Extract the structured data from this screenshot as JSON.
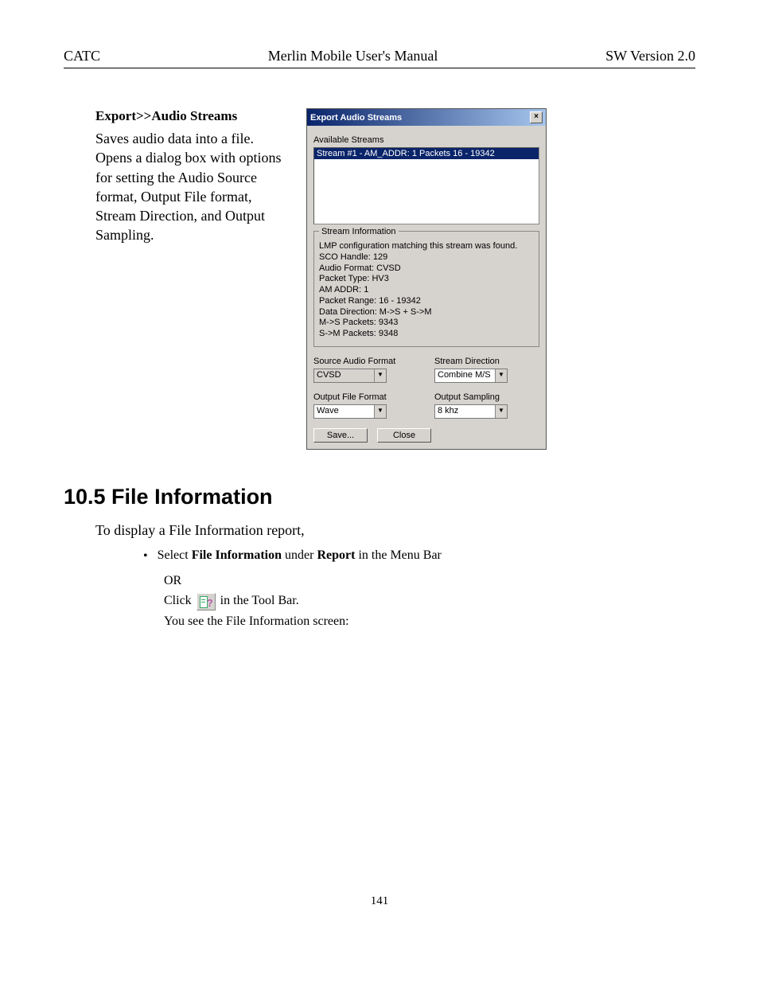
{
  "header": {
    "left": "CATC",
    "center": "Merlin Mobile User's Manual",
    "right": "SW Version 2.0"
  },
  "export_section": {
    "title": "Export>>Audio Streams",
    "body": "Saves audio data into a file. Opens a dialog box with options for setting the Audio Source format, Output File format, Stream Direction, and Output Sampling."
  },
  "dialog": {
    "title": "Export Audio Streams",
    "available_label": "Available Streams",
    "selected_stream": "Stream #1 - AM_ADDR: 1  Packets 16 - 19342",
    "stream_info_legend": "Stream Information",
    "info_lines": [
      "LMP configuration matching this stream was found.",
      "SCO Handle: 129",
      "Audio Format: CVSD",
      "Packet Type: HV3",
      "AM ADDR: 1",
      "Packet Range: 16 - 19342",
      "Data Direction: M->S + S->M",
      "M->S Packets: 9343",
      "S->M Packets: 9348"
    ],
    "labels": {
      "source_audio_format": "Source Audio Format",
      "stream_direction": "Stream Direction",
      "output_file_format": "Output File Format",
      "output_sampling": "Output Sampling"
    },
    "values": {
      "source_audio_format": "CVSD",
      "stream_direction": "Combine M/S",
      "output_file_format": "Wave",
      "output_sampling": "8 khz"
    },
    "buttons": {
      "save": "Save...",
      "close": "Close"
    }
  },
  "section_105": {
    "heading": "10.5  File Information",
    "intro": "To display a File Information report,",
    "bullet_prefix": "Select ",
    "bullet_bold1": "File Information",
    "bullet_mid": " under ",
    "bullet_bold2": "Report",
    "bullet_suffix": " in the Menu Bar",
    "or": "OR",
    "click_prefix": "Click ",
    "click_suffix": " in the Tool Bar.",
    "result": "You see the File Information screen:"
  },
  "page_number": "141"
}
